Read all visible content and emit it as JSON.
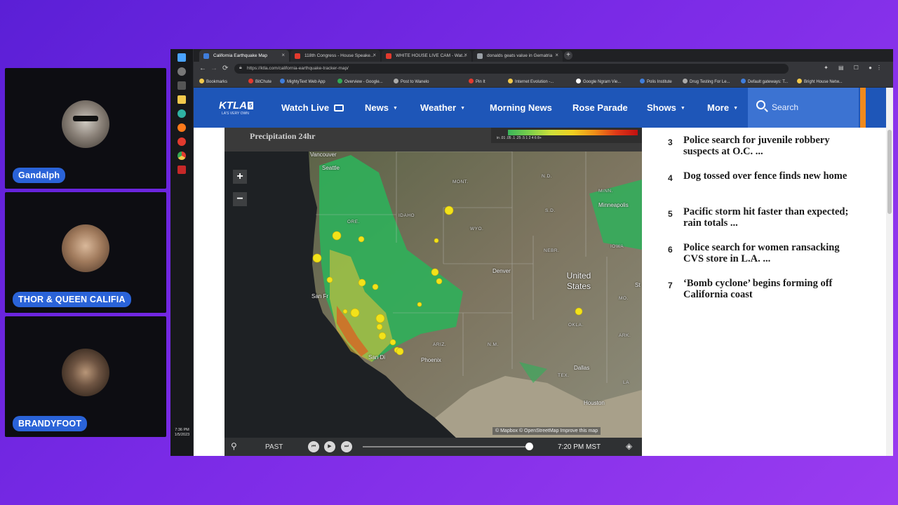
{
  "participants": [
    {
      "name": "Gandalph",
      "colors": [
        "#d8d4cc",
        "#4a4038"
      ]
    },
    {
      "name": "THOR & QUEEN CALIFIA",
      "colors": [
        "#c7a98a",
        "#6a4a34"
      ]
    },
    {
      "name": "BRANDYFOOT",
      "colors": [
        "#9c7a5e",
        "#2a1e16"
      ]
    }
  ],
  "browser": {
    "tabs": [
      {
        "label": "California Earthquake Map",
        "fav_color": "#3f7ddb",
        "active": true
      },
      {
        "label": "118th Congress - House Speake...",
        "fav_color": "#e23a2e",
        "active": false
      },
      {
        "label": "WHITE HOUSE LIVE CAM - Wat...",
        "fav_color": "#e23a2e",
        "active": false
      },
      {
        "label": "donalds geats value in Gematria",
        "fav_color": "#9aa0a6",
        "active": false
      }
    ],
    "url": "https://ktla.com/california-earthquake-tracker-map/",
    "bookmarks": [
      {
        "label": "Bookmarks",
        "color": "#f2c94c"
      },
      {
        "label": "BitChute",
        "color": "#e23a2e"
      },
      {
        "label": "MightyText Web App",
        "color": "#3f7ddb"
      },
      {
        "label": "Overview - Google...",
        "color": "#34a853"
      },
      {
        "label": "Post to Wanelo",
        "color": "#aaaaaa"
      },
      {
        "label": "Pin It",
        "color": "#e23a2e"
      },
      {
        "label": "Internet Evolution -...",
        "color": "#f2c94c"
      },
      {
        "label": "Google Ngram Vie...",
        "color": "#ffffff"
      },
      {
        "label": "Polis Institute",
        "color": "#3f7ddb"
      },
      {
        "label": "Drug Testing For Le...",
        "color": "#aaaaaa"
      },
      {
        "label": "Default gateways: T...",
        "color": "#3f7ddb"
      },
      {
        "label": "Bright House Netw...",
        "color": "#f2c94c"
      }
    ],
    "taskbar_time": "7:36 PM",
    "taskbar_date": "1/5/2023"
  },
  "site": {
    "logo": "KTLA",
    "logo_badge": "5",
    "logo_tag": "LA'S VERY OWN",
    "nav": [
      {
        "label": "Watch Live",
        "caret": false,
        "tv": true
      },
      {
        "label": "News",
        "caret": true
      },
      {
        "label": "Weather",
        "caret": true
      },
      {
        "label": "Morning News",
        "caret": false
      },
      {
        "label": "Rose Parade",
        "caret": false
      },
      {
        "label": "Shows",
        "caret": true
      },
      {
        "label": "More",
        "caret": true
      }
    ],
    "search_label": "Search",
    "accent": "#1e56b8"
  },
  "map": {
    "title": "Precipitation 24hr",
    "legend_scale": "in  .01   .05   .1   .25   .5     1     2     4     6   8+",
    "labels": {
      "vancouver": "Vancouver",
      "seattle": "Seattle",
      "mont": "MONT.",
      "nd": "N.D.",
      "minn": "MINN.",
      "minneapolis": "Minneapolis",
      "ore": "ORE.",
      "idaho": "IDAHO",
      "wyo": "WYO.",
      "sd": "S.D.",
      "nebr": "NEBR.",
      "iowa": "IOWA",
      "denver": "Denver",
      "us": "United States",
      "st": "St",
      "sanfr": "San Fr",
      "mo": "MO.",
      "okla": "OKLA.",
      "ark": "ARK.",
      "ariz": "ARIZ.",
      "nm": "N.M.",
      "sandi": "San Di",
      "phoenix": "Phoenix",
      "dallas": "Dallas",
      "tex": "TEX.",
      "la": "LA",
      "houston": "Houston"
    },
    "attribution": "© Mapbox © OpenStreetMap  Improve this map",
    "player_mode": "PAST",
    "player_time": "7:20 PM MST",
    "playback_progress": 0.98
  },
  "stories": [
    {
      "num": "3",
      "title": "Police search for juvenile robbery suspects at O.C. ..."
    },
    {
      "num": "4",
      "title": "Dog tossed over fence finds new home"
    },
    {
      "num": "5",
      "title": "Pacific storm hit faster than expected; rain totals ..."
    },
    {
      "num": "6",
      "title": "Police search for women ransacking CVS store in L.A. ..."
    },
    {
      "num": "7",
      "title": "‘Bomb cyclone’ begins forming off California coast"
    }
  ]
}
